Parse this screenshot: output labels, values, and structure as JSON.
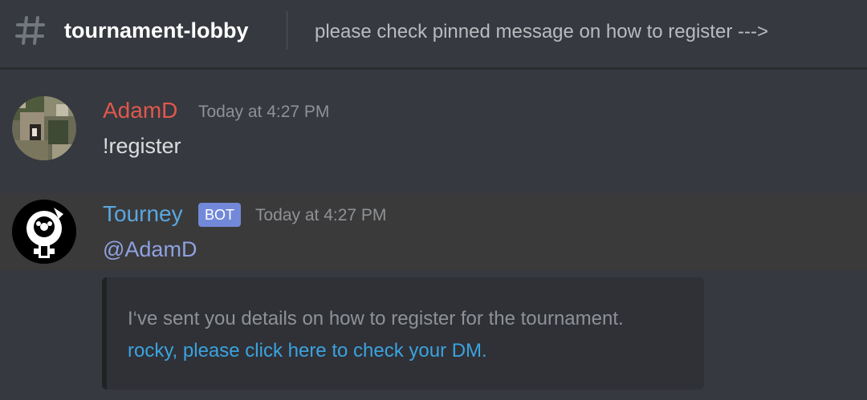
{
  "header": {
    "channel_icon": "hash-icon",
    "channel_name": "tournament-lobby",
    "topic": "please check pinned message on how to register --->"
  },
  "messages": [
    {
      "username": "AdamD",
      "username_color": "#e0584c",
      "timestamp": "Today at 4:27 PM",
      "content": "!register",
      "avatar_icon": "user-avatar"
    },
    {
      "username": "Tourney",
      "username_color": "#5aa7e0",
      "bot_tag": "BOT",
      "timestamp": "Today at 4:27 PM",
      "mention": "@AdamD",
      "avatar_icon": "bot-avatar",
      "embed": {
        "description": "I‘ve sent you details on how to register for the tournament.",
        "link_text": "rocky, please click here to check your DM."
      }
    }
  ],
  "colors": {
    "background": "#36393f",
    "highlight_row": "#3b3a3a",
    "embed_bg": "#2f3136",
    "bot_tag": "#7289da",
    "mention": "#8ea1e1",
    "link": "#3ba3e0"
  }
}
